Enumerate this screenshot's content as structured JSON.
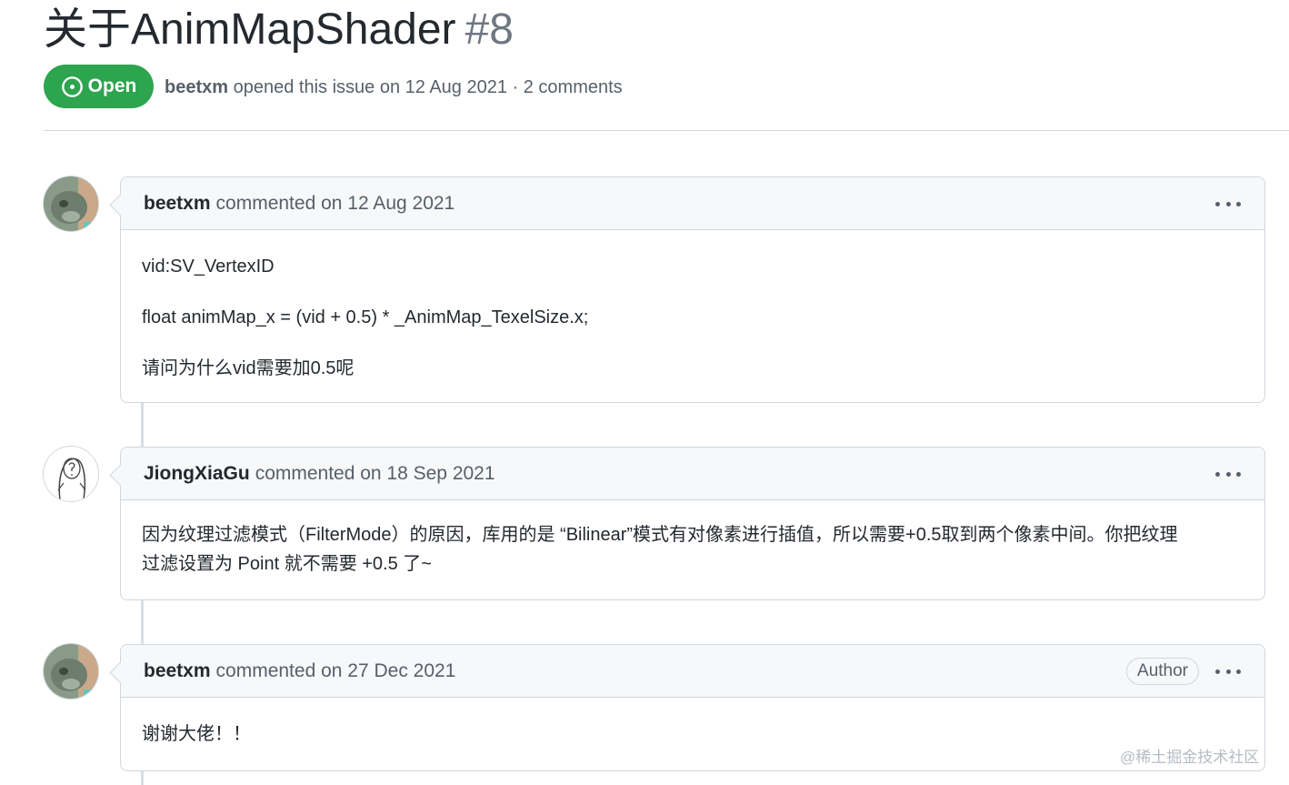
{
  "issue": {
    "title": "关于AnimMapShader",
    "number": "#8",
    "state": "Open",
    "author": "beetxm",
    "meta": "opened this issue on 12 Aug 2021 · 2 comments"
  },
  "comments": [
    {
      "author": "beetxm",
      "action": "commented on 12 Aug 2021",
      "body": [
        "vid:SV_VertexID",
        "float animMap_x = (vid + 0.5) * _AnimMap_TexelSize.x;",
        "请问为什么vid需要加0.5呢"
      ]
    },
    {
      "author": "JiongXiaGu",
      "action": "commented on 18 Sep 2021",
      "body": [
        "因为纹理过滤模式（FilterMode）的原因，库用的是 “Bilinear”模式有对像素进行插值，所以需要+0.5取到两个像素中间。你把纹理",
        "过滤设置为 Point 就不需要 +0.5 了~"
      ]
    },
    {
      "author": "beetxm",
      "action": "commented on 27 Dec 2021",
      "badge": "Author",
      "body": [
        "谢谢大佬！！"
      ]
    }
  ],
  "watermark": "@稀土掘金技术社区",
  "colors": {
    "open_green": "#2da44e",
    "border": "#d0d7de",
    "header_bg": "#f6f8fa",
    "muted_text": "#57606a"
  },
  "icons": {
    "state": "issue-opened-icon",
    "menu": "kebab-horizontal-icon"
  }
}
